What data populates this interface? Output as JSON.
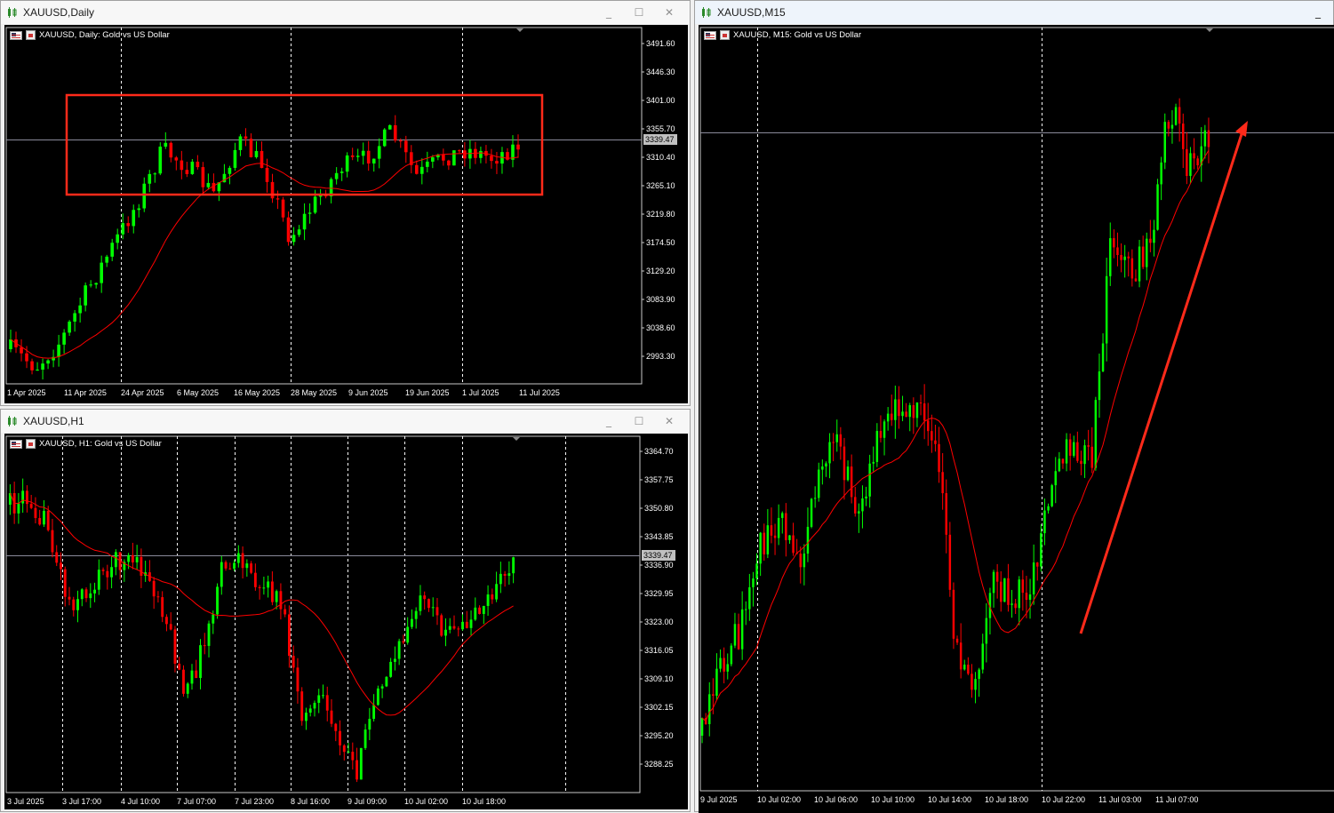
{
  "windows": {
    "daily": {
      "title": "XAUUSD,Daily",
      "symbol_label": "XAUUSD, Daily:  Gold vs US Dollar",
      "price_axis": [
        "3491.60",
        "3446.30",
        "3401.00",
        "3355.70",
        "3310.40",
        "3265.10",
        "3219.80",
        "3174.50",
        "3129.20",
        "3083.90",
        "3038.60",
        "2993.30"
      ],
      "current_price": "3339.47",
      "time_axis": [
        "1 Apr 2025",
        "11 Apr 2025",
        "24 Apr 2025",
        "6 May 2025",
        "16 May 2025",
        "28 May 2025",
        "9 Jun 2025",
        "19 Jun 2025",
        "1 Jul 2025",
        "11 Jul 2025"
      ]
    },
    "h1": {
      "title": "XAUUSD,H1",
      "symbol_label": "XAUUSD, H1:  Gold vs US Dollar",
      "price_axis": [
        "3364.70",
        "3357.75",
        "3350.80",
        "3343.85",
        "3336.90",
        "3329.95",
        "3323.00",
        "3316.05",
        "3309.10",
        "3302.15",
        "3295.20",
        "3288.25"
      ],
      "current_price": "3339.47",
      "time_axis": [
        "3 Jul 2025",
        "3 Jul 17:00",
        "4 Jul 10:00",
        "7 Jul 07:00",
        "7 Jul 23:00",
        "8 Jul 16:00",
        "9 Jul 09:00",
        "10 Jul 02:00",
        "10 Jul 18:00"
      ]
    },
    "m15": {
      "title": "XAUUSD,M15",
      "symbol_label": "XAUUSD, M15:  Gold vs US Dollar",
      "time_axis": [
        "9 Jul 2025",
        "10 Jul 02:00",
        "10 Jul 06:00",
        "10 Jul 10:00",
        "10 Jul 14:00",
        "10 Jul 18:00",
        "10 Jul 22:00",
        "11 Jul 03:00",
        "11 Jul 07:00"
      ]
    }
  },
  "buttons": {
    "minimize": "_",
    "maximize": "☐",
    "close": "✕"
  },
  "colors": {
    "bull": "#00ff00",
    "bear": "#ff0000",
    "ma": "#ff0000",
    "background": "#000000",
    "grid": "#ffffff",
    "annotation": "#ff2a1a"
  },
  "icons": {
    "chart": "candlestick-chart-icon"
  }
}
